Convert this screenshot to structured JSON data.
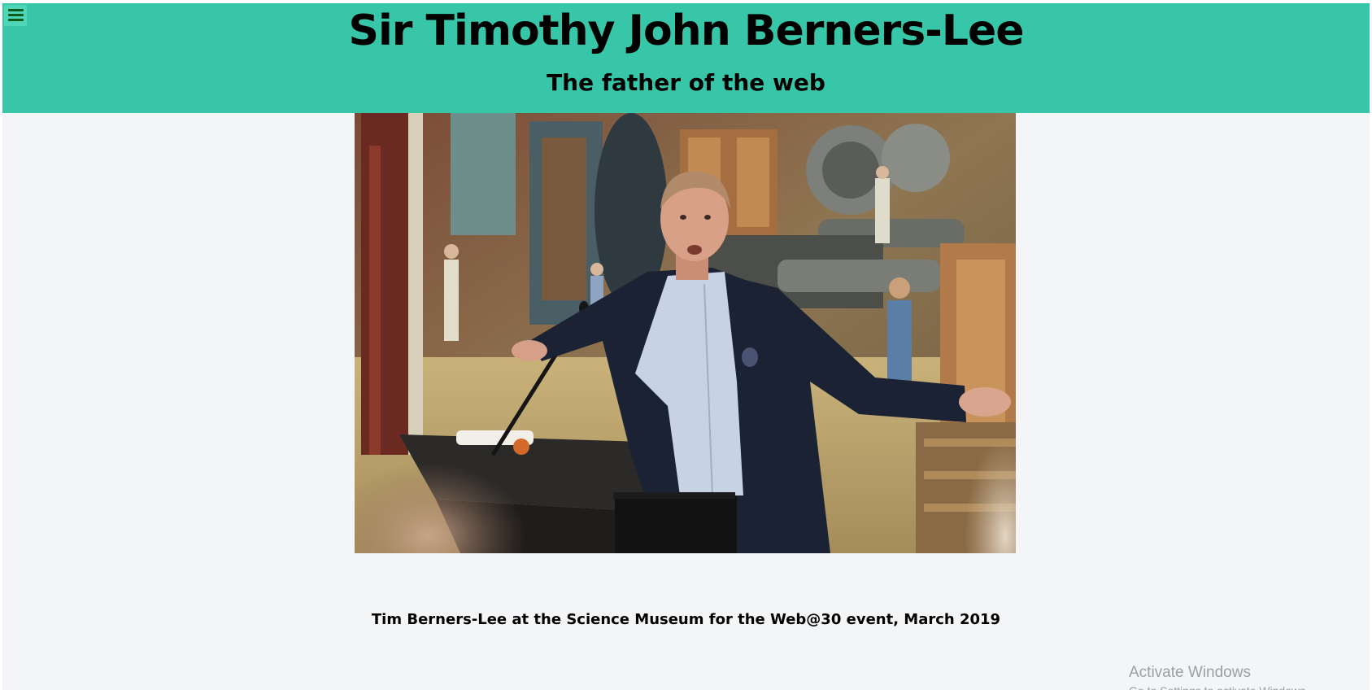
{
  "header": {
    "title": "Sir Timothy John Berners-Lee",
    "subtitle": "The father of the web",
    "background_color": "#37c6a7",
    "menu_icon": "hamburger-menu-icon"
  },
  "main": {
    "image_caption": "Tim Berners-Lee at the Science Museum for the Web@30 event, March 2019"
  },
  "os_overlay": {
    "title": "Activate Windows",
    "subtitle": "Go to Settings to activate Windows."
  }
}
